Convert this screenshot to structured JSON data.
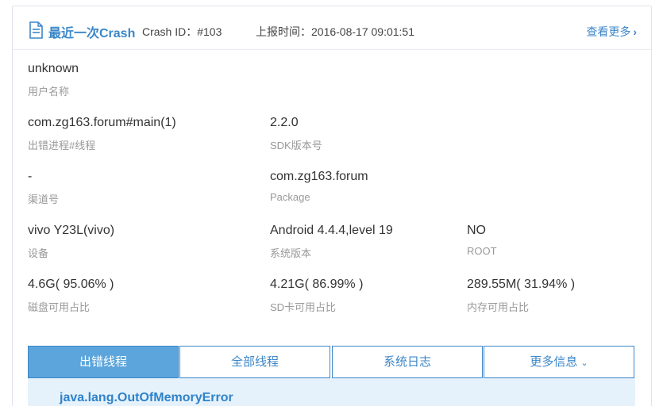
{
  "header": {
    "icon": "document-icon",
    "title": "最近一次Crash",
    "crash_id": "Crash ID：#103",
    "report_time": "上报时间：2016-08-17 09:01:51",
    "view_more": "查看更多"
  },
  "fields": {
    "user_name": {
      "value": "unknown",
      "label": "用户名称"
    },
    "process_thread": {
      "value": "com.zg163.forum#main(1)",
      "label": "出错进程#线程"
    },
    "sdk_version": {
      "value": "2.2.0",
      "label": "SDK版本号"
    },
    "channel": {
      "value": "-",
      "label": "渠道号"
    },
    "package": {
      "value": "com.zg163.forum",
      "label": "Package"
    },
    "device": {
      "value": "vivo Y23L(vivo)",
      "label": "设备"
    },
    "os_version": {
      "value": "Android 4.4.4,level 19",
      "label": "系统版本"
    },
    "root": {
      "value": "NO",
      "label": "ROOT"
    },
    "disk": {
      "value": "4.6G( 95.06% )",
      "label": "磁盘可用占比"
    },
    "sd_card": {
      "value": "4.21G( 86.99% )",
      "label": "SD卡可用占比"
    },
    "memory": {
      "value": "289.55M( 31.94% )",
      "label": "内存可用占比"
    }
  },
  "tabs": [
    {
      "label": "出错线程",
      "active": true
    },
    {
      "label": "全部线程",
      "active": false
    },
    {
      "label": "系统日志",
      "active": false
    },
    {
      "label": "更多信息",
      "active": false
    }
  ],
  "error": {
    "text": "java.lang.OutOfMemoryError"
  },
  "colors": {
    "accent": "#3c87c8",
    "active_tab": "#5ba5dc",
    "error_bg": "#e5f2fb"
  }
}
